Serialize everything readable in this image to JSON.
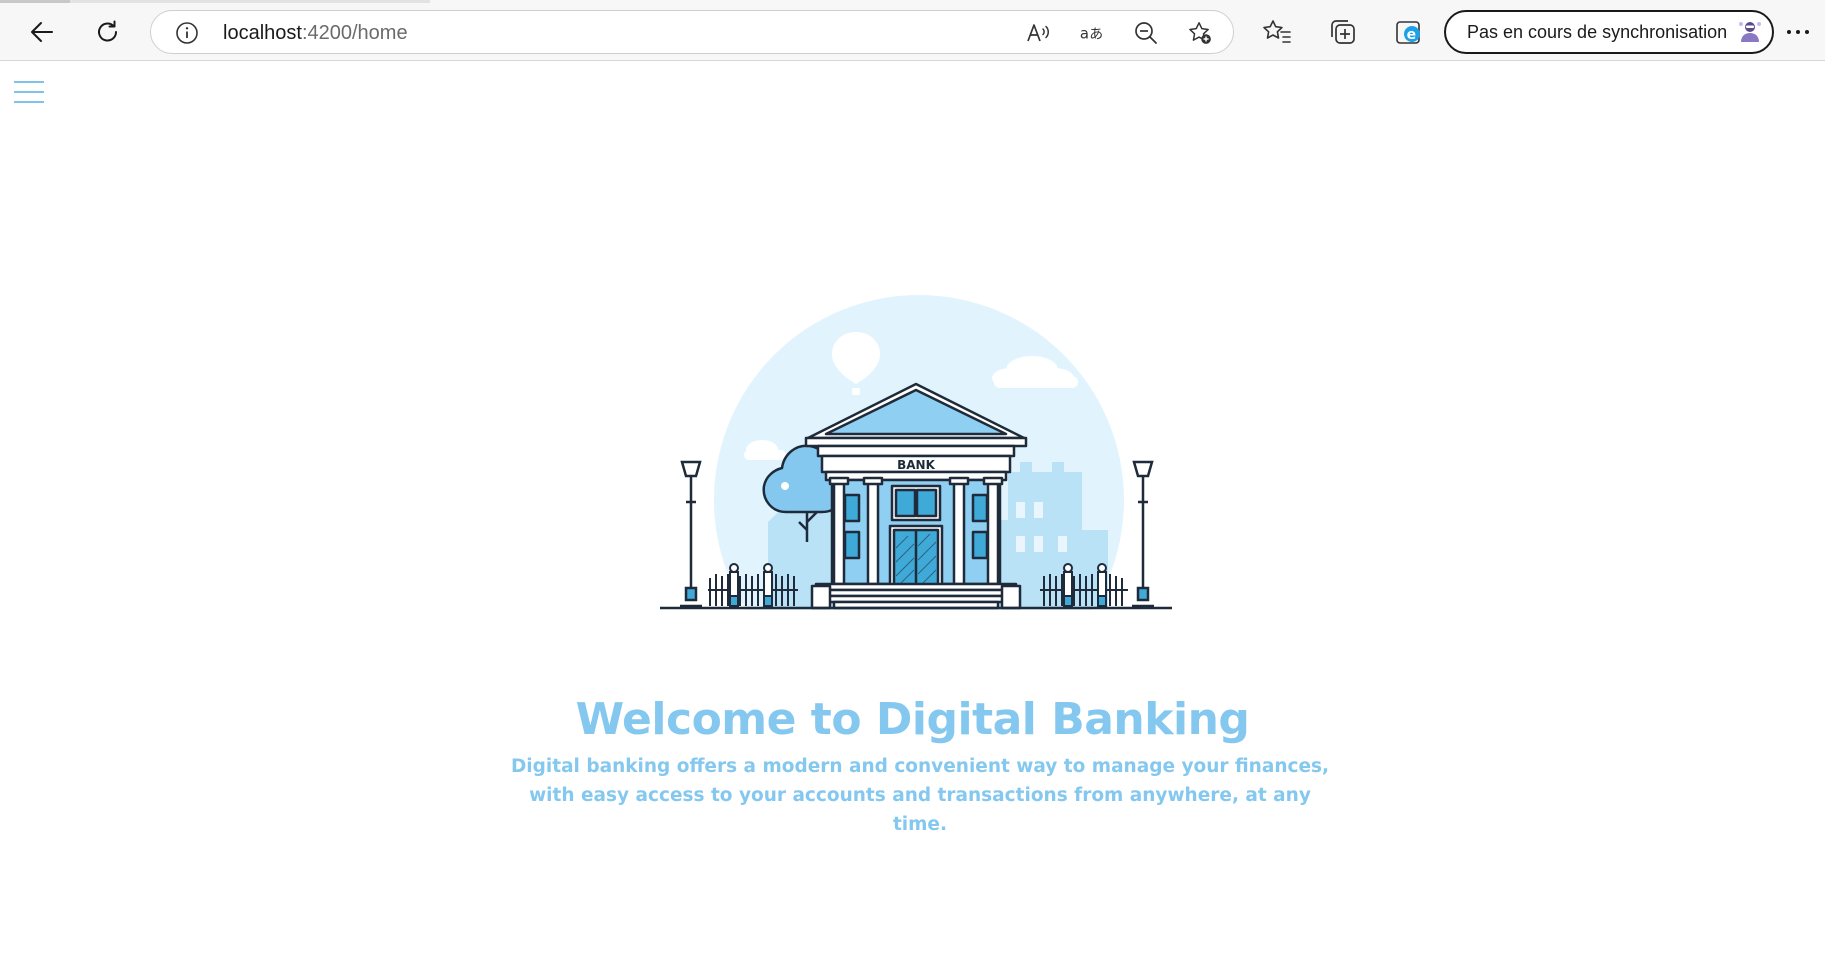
{
  "browser": {
    "url_host": "localhost",
    "url_path": ":4200/home",
    "sync_label": "Pas en cours de synchronisation",
    "icons": [
      "back-icon",
      "refresh-icon",
      "site-info-icon",
      "read-aloud-icon",
      "translate-icon",
      "zoom-out-icon",
      "add-favorite-icon",
      "favorites-icon",
      "collections-icon",
      "ie-mode-icon",
      "profile-avatar",
      "more-icon"
    ]
  },
  "page": {
    "menu_icon": "hamburger-icon",
    "illustration": {
      "sign_text": "BANK"
    },
    "title": "Welcome to Digital Banking",
    "description": "Digital banking offers a modern and convenient way to manage your finances, with easy access to your accounts and transactions from anywhere, at any time."
  },
  "colors": {
    "accent": "#85c8ef",
    "illustration_light": "#e1f4fd",
    "illustration_mid": "#8fd0f2",
    "illustration_dark": "#3fa9d8",
    "outline": "#1f2b3a"
  }
}
